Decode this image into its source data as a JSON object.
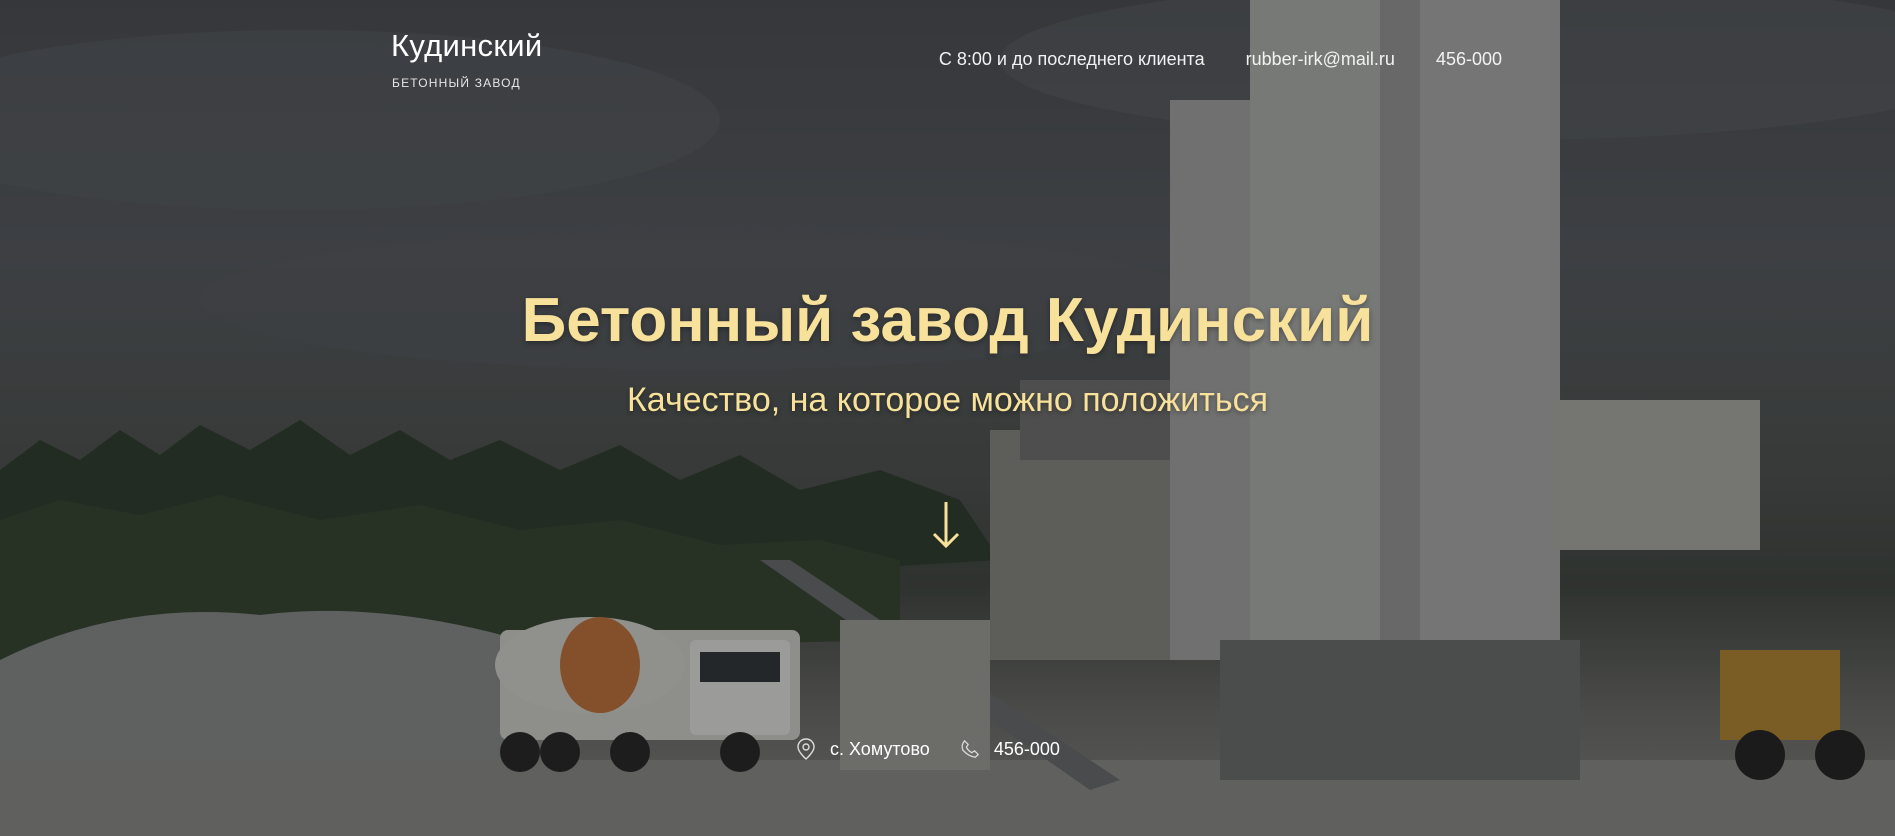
{
  "header": {
    "brand_name": "Кудинский",
    "brand_tagline": "БЕТОННЫЙ ЗАВОД",
    "hours": "С 8:00 и до последнего клиента",
    "email": "rubber-irk@mail.ru",
    "phone": "456-000"
  },
  "hero": {
    "title": "Бетонный завод Кудинский",
    "subtitle": "Качество, на которое можно положиться",
    "scroll_icon": "arrow-down-icon"
  },
  "footer_info": {
    "location_icon": "location-pin-icon",
    "location": "с. Хомутово",
    "phone_icon": "phone-icon",
    "phone": "456-000"
  },
  "colors": {
    "accent": "#f8e19a",
    "text": "#ffffff"
  }
}
